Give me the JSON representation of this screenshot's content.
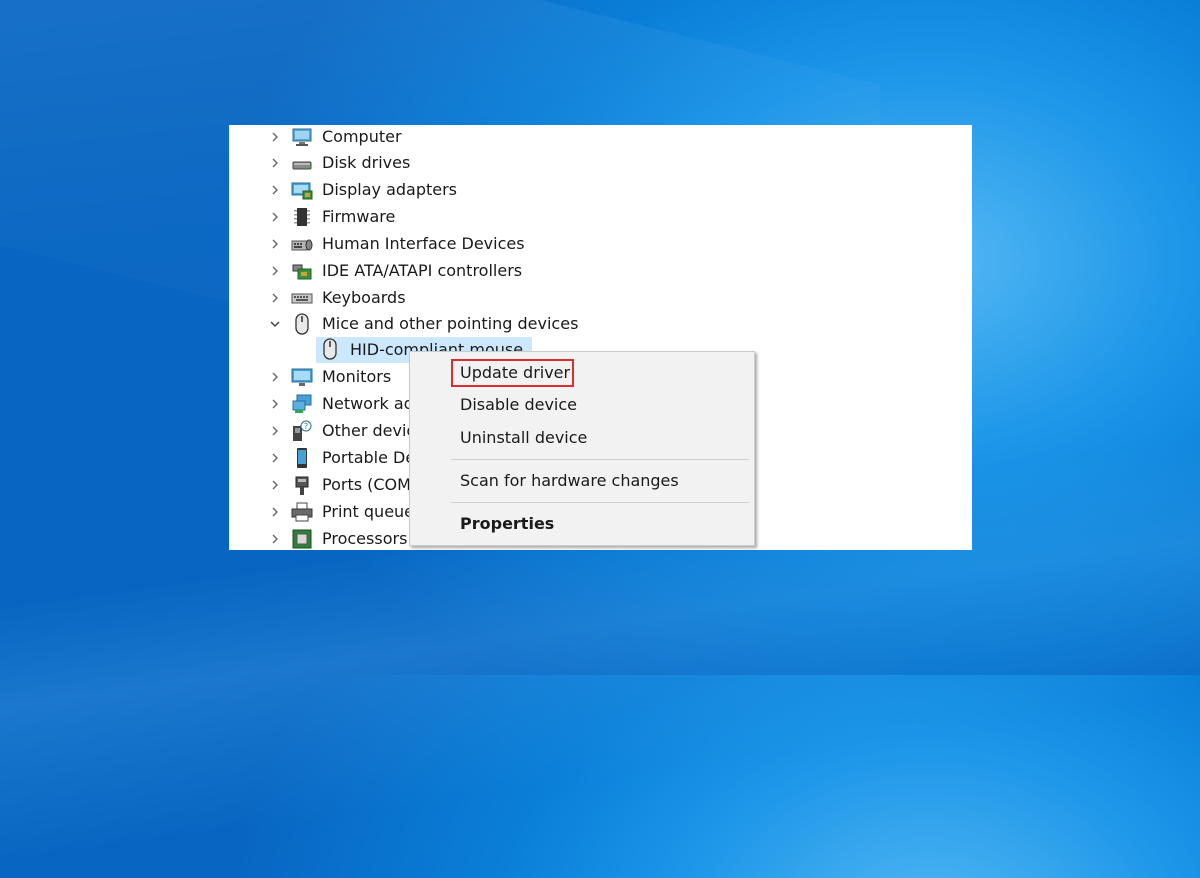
{
  "device_tree": [
    {
      "label": "Computer",
      "expanded": false,
      "icon": "computer-icon"
    },
    {
      "label": "Disk drives",
      "expanded": false,
      "icon": "disk-drive-icon"
    },
    {
      "label": "Display adapters",
      "expanded": false,
      "icon": "display-adapter-icon"
    },
    {
      "label": "Firmware",
      "expanded": false,
      "icon": "firmware-icon"
    },
    {
      "label": "Human Interface Devices",
      "expanded": false,
      "icon": "hid-icon"
    },
    {
      "label": "IDE ATA/ATAPI controllers",
      "expanded": false,
      "icon": "ide-controller-icon"
    },
    {
      "label": "Keyboards",
      "expanded": false,
      "icon": "keyboard-icon"
    },
    {
      "label": "Mice and other pointing devices",
      "expanded": true,
      "icon": "mouse-icon"
    },
    {
      "label": "Monitors",
      "expanded": false,
      "icon": "monitor-icon"
    },
    {
      "label": "Network ad",
      "expanded": false,
      "icon": "network-adapter-icon"
    },
    {
      "label": "Other devic",
      "expanded": false,
      "icon": "other-devices-icon"
    },
    {
      "label": "Portable De",
      "expanded": false,
      "icon": "portable-device-icon"
    },
    {
      "label": "Ports (COM",
      "expanded": false,
      "icon": "ports-icon"
    },
    {
      "label": "Print queue",
      "expanded": false,
      "icon": "printer-icon"
    },
    {
      "label": "Processors",
      "expanded": false,
      "icon": "processor-icon"
    }
  ],
  "selected_child": {
    "label": "HID-compliant mouse",
    "icon": "mouse-icon"
  },
  "context_menu": {
    "items": [
      {
        "label": "Update driver",
        "highlighted": true
      },
      {
        "label": "Disable device"
      },
      {
        "label": "Uninstall device"
      },
      {
        "label": "Scan for hardware changes"
      },
      {
        "label": "Properties",
        "bold": true
      }
    ],
    "highlight_color": "#d7302f"
  },
  "colors": {
    "selection": "#cce8ff",
    "desktop": "#0a7fd8"
  }
}
